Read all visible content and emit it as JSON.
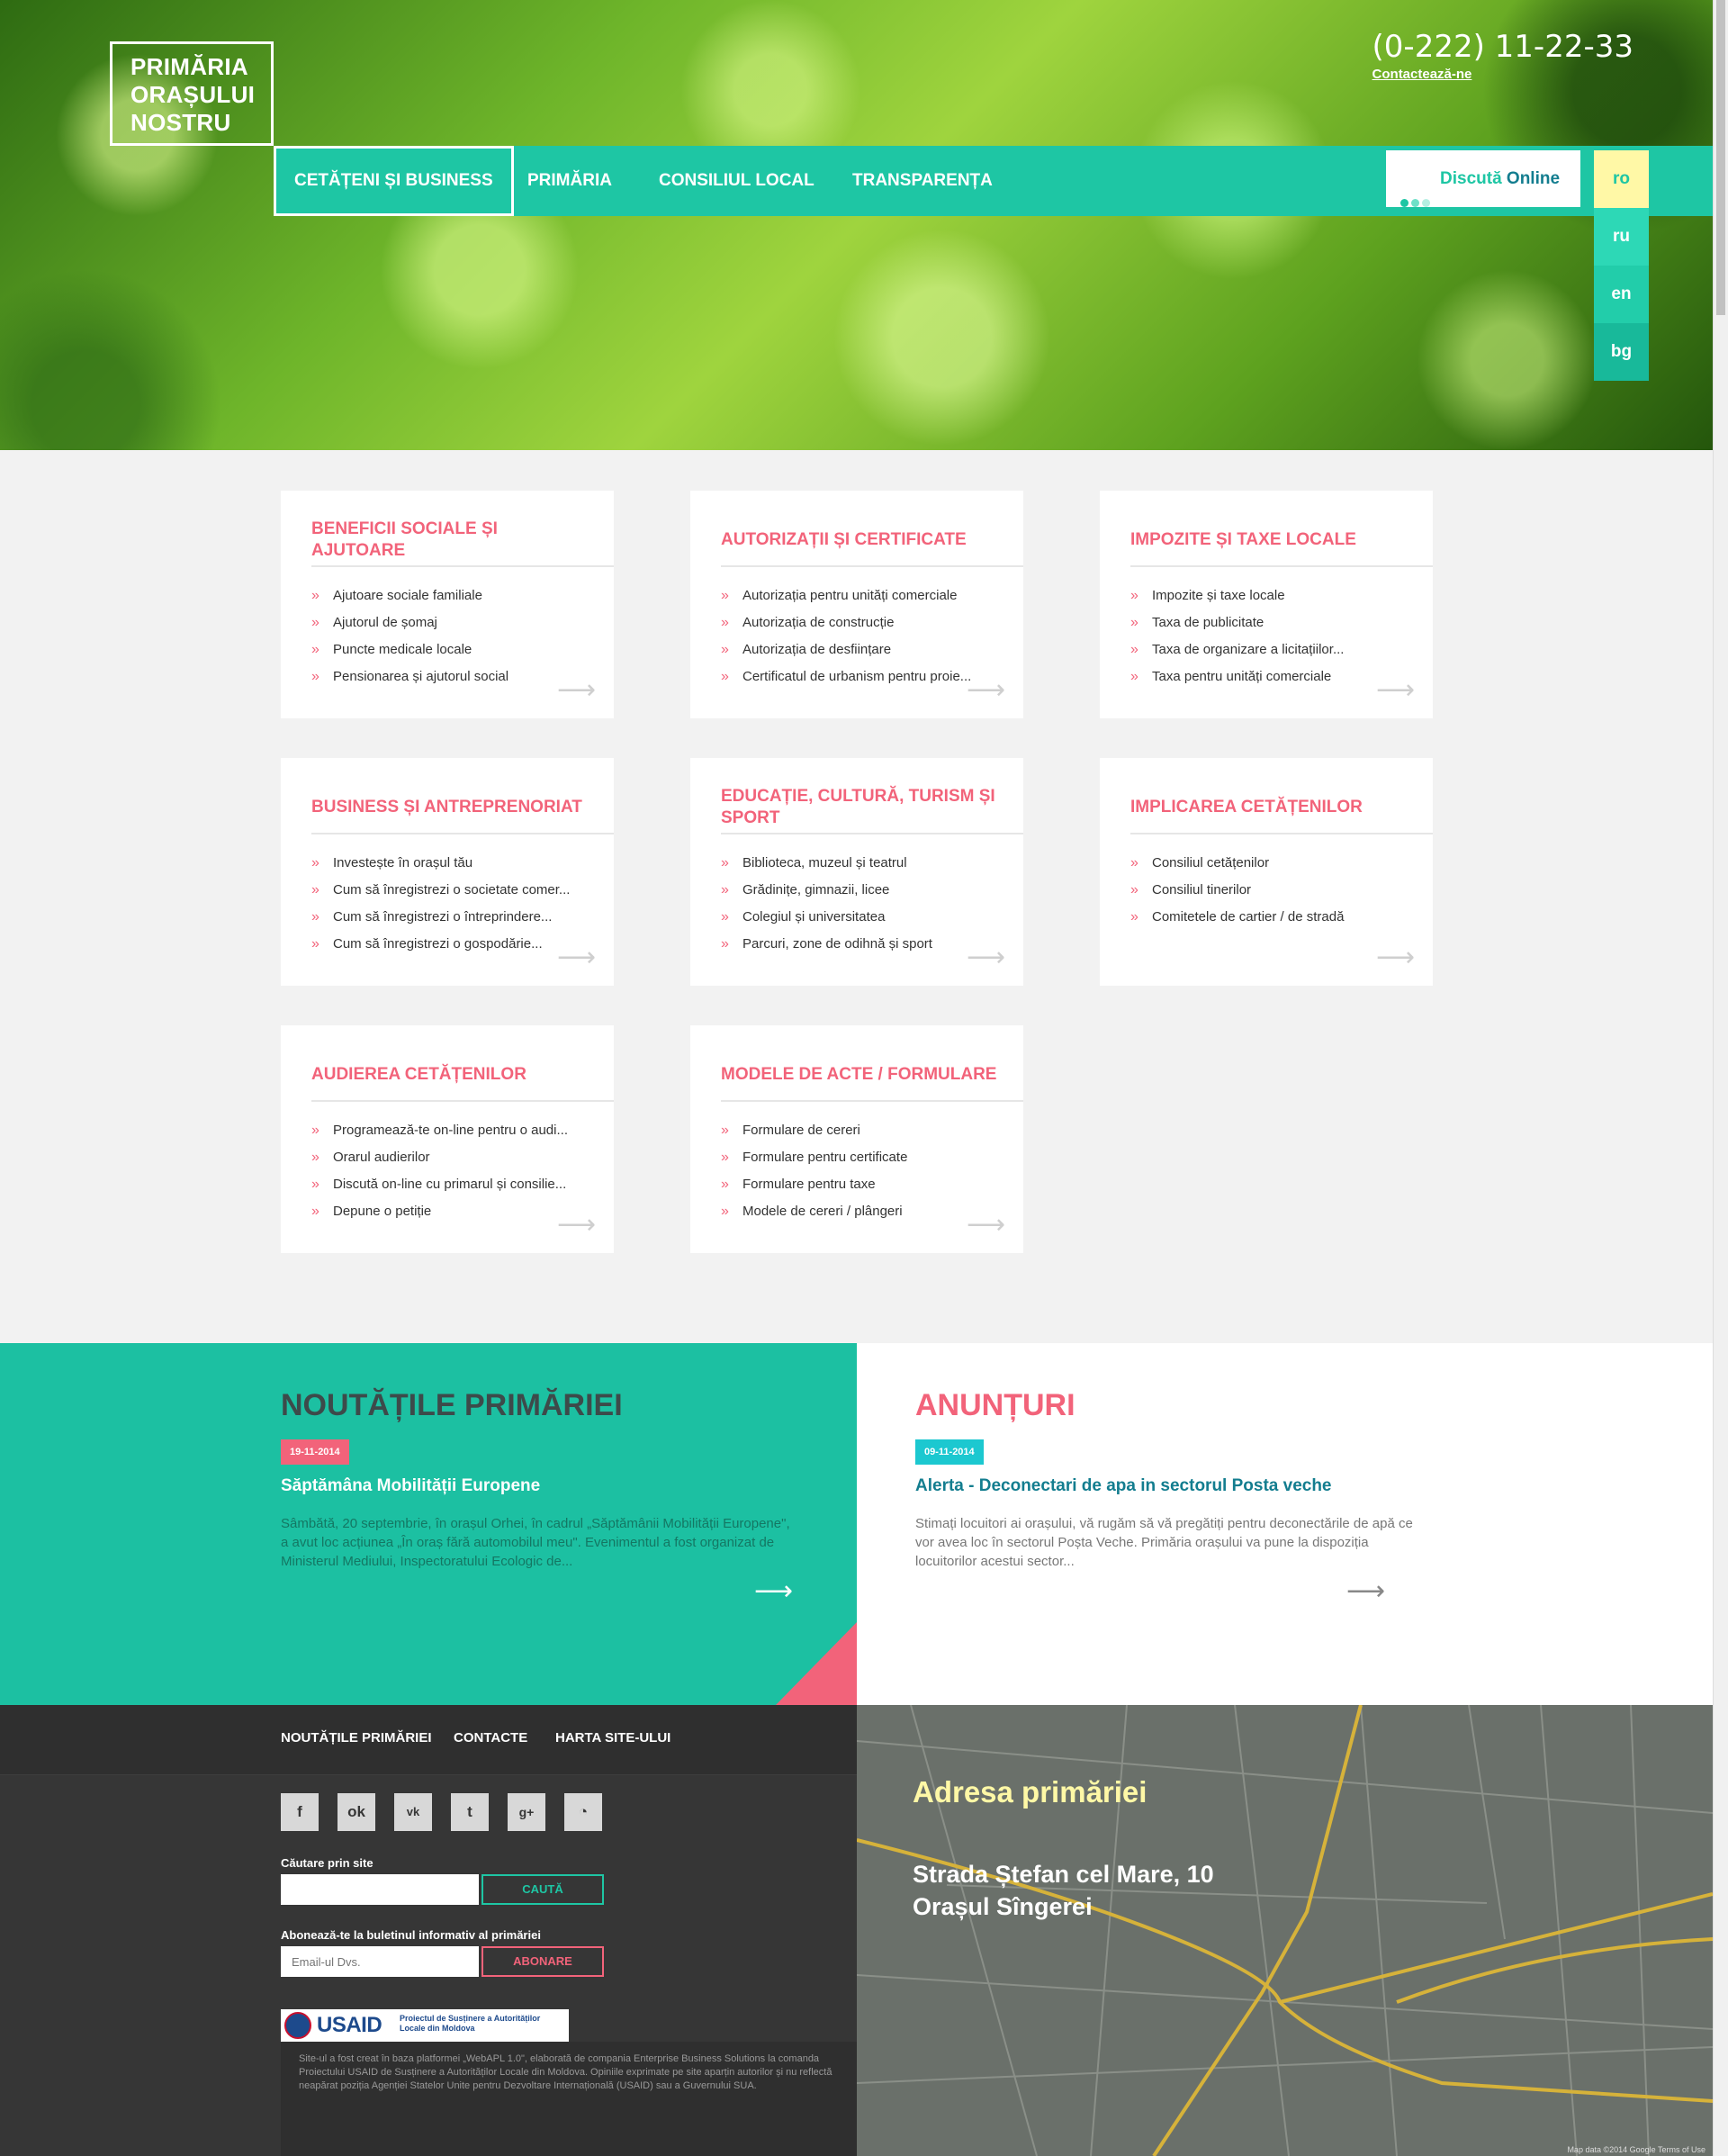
{
  "header": {
    "logo_lines": [
      "PRIMĂRIA",
      "ORAȘULUI",
      "NOSTRU"
    ],
    "phone": "(0-222) 11-22-33",
    "contact_link": "Contactează-ne"
  },
  "nav": {
    "items": [
      "CETĂȚENI ȘI BUSINESS",
      "PRIMĂRIA",
      "CONSILIUL LOCAL",
      "TRANSPARENȚA"
    ],
    "chat_a": "Discută",
    "chat_b": " Online",
    "languages": [
      "ro",
      "ru",
      "en",
      "bg"
    ],
    "active_language": "ro"
  },
  "cards": [
    {
      "title": "BENEFICII SOCIALE ȘI AJUTOARE",
      "items": [
        "Ajutoare sociale familiale",
        "Ajutorul de șomaj",
        "Puncte medicale locale",
        "Pensionarea și ajutorul social"
      ]
    },
    {
      "title": "AUTORIZAȚII ȘI CERTIFICATE",
      "items": [
        "Autorizația pentru unități comerciale",
        "Autorizația de construcție",
        "Autorizația de desființare",
        "Certificatul de urbanism pentru proie..."
      ]
    },
    {
      "title": "IMPOZITE ȘI TAXE LOCALE",
      "items": [
        "Impozite și taxe locale",
        "Taxa de publicitate",
        "Taxa de organizare a licitațiilor...",
        "Taxa pentru unități comerciale"
      ]
    },
    {
      "title": "BUSINESS ȘI ANTREPRENORIAT",
      "items": [
        "Investește în orașul tău",
        "Cum să înregistrezi o societate comer...",
        "Cum să înregistrezi o întreprindere...",
        "Cum să înregistrezi o gospodărie..."
      ]
    },
    {
      "title": "EDUCAȚIE, CULTURĂ, TURISM ȘI SPORT",
      "items": [
        "Biblioteca, muzeul și teatrul",
        "Grădinițe, gimnazii, licee",
        "Colegiul și universitatea",
        "Parcuri, zone de odihnă și sport"
      ]
    },
    {
      "title": "IMPLICAREA CETĂȚENILOR",
      "items": [
        "Consiliul cetățenilor",
        "Consiliul tinerilor",
        "Comitetele de cartier / de stradă"
      ]
    },
    {
      "title": "AUDIEREA CETĂȚENILOR",
      "items": [
        "Programează-te on-line pentru o audi...",
        "Orarul audierilor",
        "Discută on-line cu primarul și consilie...",
        "Depune o petiție"
      ]
    },
    {
      "title": "MODELE DE ACTE / FORMULARE",
      "items": [
        "Formulare de cereri",
        "Formulare pentru certificate",
        "Formulare pentru taxe",
        "Modele de cereri / plângeri"
      ]
    }
  ],
  "news": {
    "title": "NOUTĂȚILE PRIMĂRIEI",
    "date": "19-11-2014",
    "headline": "Săptămâna Mobilității Europene",
    "text": "Sâmbătă, 20 septembrie, în orașul Orhei, în cadrul „Săptămânii Mobilității Europene\", a avut loc acțiunea „În oraș fără automobilul meu\". Evenimentul a fost organizat de Ministerul Mediului, Inspectoratului Ecologic de..."
  },
  "announcements": {
    "title": "ANUNȚURI",
    "date": "09-11-2014",
    "headline": "Alerta - Deconectari de apa in sectorul Posta veche",
    "text": "Stimați locuitori ai orașului, vă rugăm să vă pregătiți pentru deconectările de apă ce vor avea loc în sectorul Poșta Veche. Primăria orașului va pune la dispoziția locuitorilor acestui sector..."
  },
  "footer": {
    "links": [
      "NOUTĂȚILE PRIMĂRIEI",
      "CONTACTE",
      "HARTA SITE-ULUI"
    ],
    "social_icons": [
      "facebook-icon",
      "odnoklassniki-icon",
      "vk-icon",
      "twitter-icon",
      "google-plus-icon",
      "rss-icon"
    ],
    "search_label": "Căutare prin site",
    "search_button": "CAUTĂ",
    "newsletter_label": "Abonează-te la buletinul informativ al primăriei",
    "email_placeholder": "Email-ul Dvs.",
    "subscribe_button": "ABONARE",
    "usaid_brand": "USAID",
    "usaid_project": "Proiectul de Susținere a Autorităților Locale din Moldova",
    "disclaimer": "Site-ul a fost creat în baza platformei „WebAPL 1.0\", elaborată de compania Enterprise Business Solutions la comanda Proiectului USAID de Susținere a Autorităților Locale din Moldova. Opiniile exprimate pe site aparțin autorilor și nu reflectă neapărat poziția Agenției Statelor Unite pentru Dezvoltare Internațională (USAID) sau a Guvernului SUA."
  },
  "map": {
    "title": "Adresa primăriei",
    "address_line1": "Strada Ștefan cel Mare, 10",
    "address_line2": "Orașul Sîngerei",
    "credit": "Map data ©2014 Google   Terms of Use"
  },
  "colors": {
    "accent_teal": "#1ec6a4",
    "accent_pink": "#f2637a",
    "accent_yellow": "#fff8a6",
    "footer_dark": "#363636"
  }
}
